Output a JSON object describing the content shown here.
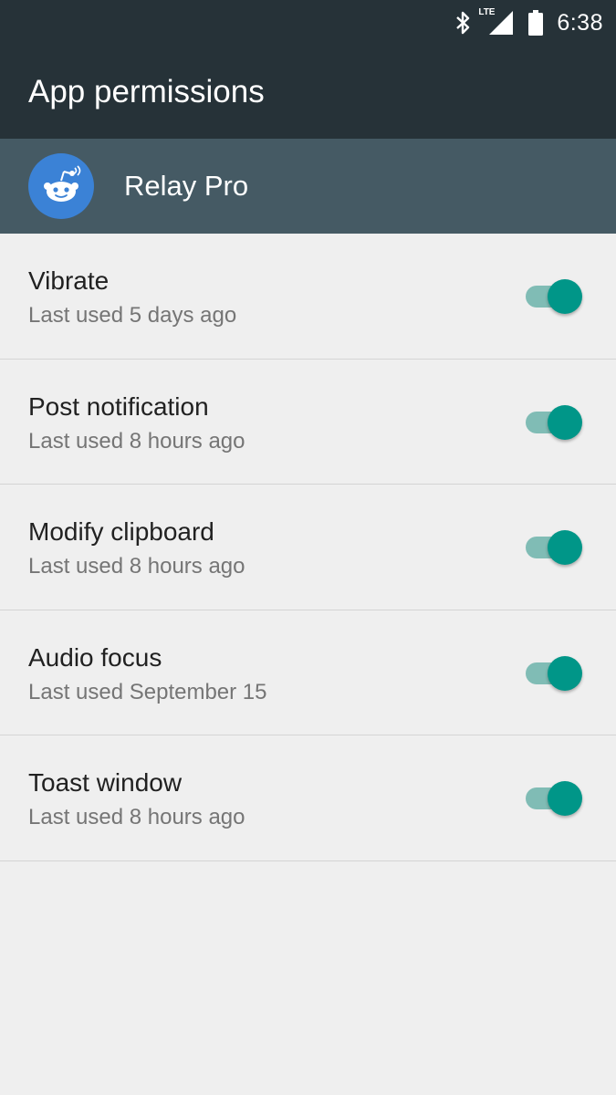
{
  "status_bar": {
    "time": "6:38",
    "network_label": "LTE",
    "icons": [
      "bluetooth-icon",
      "lte-signal-icon",
      "battery-icon"
    ]
  },
  "app_bar": {
    "title": "App permissions"
  },
  "app_header": {
    "app_name": "Relay Pro",
    "icon": "reddit-alien-icon",
    "icon_color": "#3b82d6"
  },
  "permissions": [
    {
      "title": "Vibrate",
      "subtitle": "Last used 5 days ago",
      "enabled": true
    },
    {
      "title": "Post notification",
      "subtitle": "Last used 8 hours ago",
      "enabled": true
    },
    {
      "title": "Modify clipboard",
      "subtitle": "Last used 8 hours ago",
      "enabled": true
    },
    {
      "title": "Audio focus",
      "subtitle": "Last used September 15",
      "enabled": true
    },
    {
      "title": "Toast window",
      "subtitle": "Last used 8 hours ago",
      "enabled": true
    }
  ],
  "colors": {
    "toolbar": "#263238",
    "header": "#455a64",
    "accent": "#009688",
    "background": "#efefef"
  }
}
